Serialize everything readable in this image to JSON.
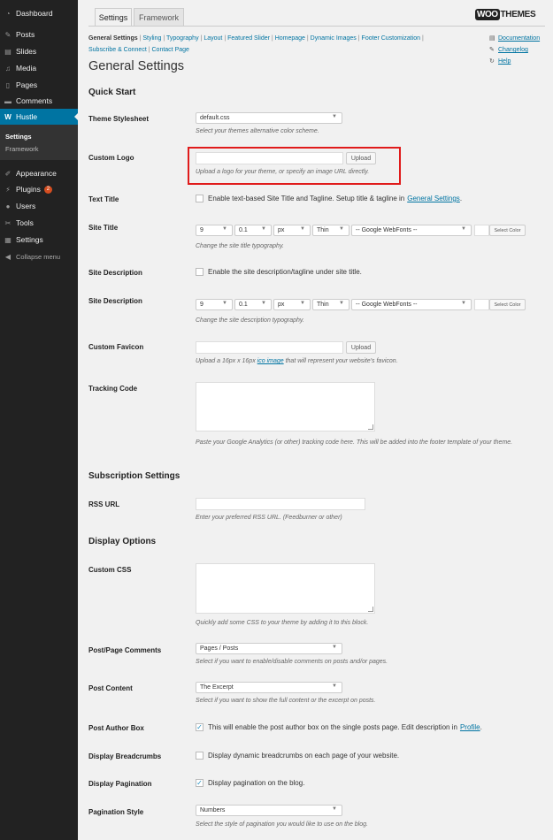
{
  "sidebar": {
    "items": [
      {
        "label": "Dashboard",
        "icon": "dashboard-icon",
        "glyph": "◔"
      },
      {
        "label": "Posts",
        "icon": "pin-icon",
        "glyph": "✎"
      },
      {
        "label": "Slides",
        "icon": "slides-icon",
        "glyph": "▤"
      },
      {
        "label": "Media",
        "icon": "media-icon",
        "glyph": "♫"
      },
      {
        "label": "Pages",
        "icon": "pages-icon",
        "glyph": "▯"
      },
      {
        "label": "Comments",
        "icon": "comment-icon",
        "glyph": "▬"
      },
      {
        "label": "Hustle",
        "icon": "woo-icon",
        "glyph": "W"
      },
      {
        "label": "Appearance",
        "icon": "brush-icon",
        "glyph": "✐"
      },
      {
        "label": "Plugins",
        "icon": "plug-icon",
        "glyph": "⚡",
        "badge": "2"
      },
      {
        "label": "Users",
        "icon": "user-icon",
        "glyph": "●"
      },
      {
        "label": "Tools",
        "icon": "wrench-icon",
        "glyph": "✂"
      },
      {
        "label": "Settings",
        "icon": "settings-icon",
        "glyph": "▦"
      },
      {
        "label": "Collapse menu",
        "icon": "collapse-icon",
        "glyph": "◀"
      }
    ],
    "submenu": [
      "Settings",
      "Framework"
    ]
  },
  "tabs": [
    "Settings",
    "Framework"
  ],
  "logo": {
    "woo": "WOO",
    "themes": "THEMES"
  },
  "subnav": [
    "General Settings",
    "Styling",
    "Typography",
    "Layout",
    "Featured Slider",
    "Homepage",
    "Dynamic Images",
    "Footer Customization",
    "Subscribe & Connect",
    "Contact Page"
  ],
  "help_links": [
    {
      "label": "Documentation",
      "icon": "document-icon"
    },
    {
      "label": "Changelog",
      "icon": "wrench-icon"
    },
    {
      "label": "Help",
      "icon": "refresh-icon"
    }
  ],
  "page_title": "General Settings",
  "sections": {
    "quick_start": "Quick Start",
    "subscription": "Subscription Settings",
    "display": "Display Options"
  },
  "fields": {
    "stylesheet": {
      "label": "Theme Stylesheet",
      "value": "default.css",
      "desc": "Select your themes alternative color scheme."
    },
    "logo": {
      "label": "Custom Logo",
      "button": "Upload",
      "desc": "Upload a logo for your theme, or specify an image URL directly."
    },
    "text_title": {
      "label": "Text Title",
      "text": "Enable text-based Site Title and Tagline. Setup title & tagline in",
      "link": "General Settings",
      "suffix": "."
    },
    "site_title": {
      "label": "Site Title",
      "size": "9",
      "line": "0.1",
      "unit": "px",
      "weight": "Thin",
      "font": "-- Google WebFonts --",
      "color_btn": "Select Color",
      "desc": "Change the site title typography."
    },
    "site_desc_toggle": {
      "label": "Site Description",
      "text": "Enable the site description/tagline under site title."
    },
    "site_desc": {
      "label": "Site Description",
      "size": "9",
      "line": "0.1",
      "unit": "px",
      "weight": "Thin",
      "font": "-- Google WebFonts --",
      "color_btn": "Select Color",
      "desc": "Change the site description typography."
    },
    "favicon": {
      "label": "Custom Favicon",
      "button": "Upload",
      "desc_pre": "Upload a 16px x 16px",
      "desc_link": "ico image",
      "desc_post": "that will represent your website's favicon."
    },
    "tracking": {
      "label": "Tracking Code",
      "desc": "Paste your Google Analytics (or other) tracking code here. This will be added into the footer template of your theme."
    },
    "rss": {
      "label": "RSS URL",
      "desc": "Enter your preferred RSS URL. (Feedburner or other)"
    },
    "css": {
      "label": "Custom CSS",
      "desc": "Quickly add some CSS to your theme by adding it to this block."
    },
    "comments": {
      "label": "Post/Page Comments",
      "value": "Pages / Posts",
      "desc": "Select if you want to enable/disable comments on posts and/or pages."
    },
    "content": {
      "label": "Post Content",
      "value": "The Excerpt",
      "desc": "Select if you want to show the full content or the excerpt on posts."
    },
    "author": {
      "label": "Post Author Box",
      "text": "This will enable the post author box on the single posts page. Edit description in",
      "link": "Profile",
      "suffix": "."
    },
    "breadcrumbs": {
      "label": "Display Breadcrumbs",
      "text": "Display dynamic breadcrumbs on each page of your website."
    },
    "pagination": {
      "label": "Display Pagination",
      "text": "Display pagination on the blog."
    },
    "pag_style": {
      "label": "Pagination Style",
      "value": "Numbers",
      "desc": "Select the style of pagination you would like to use on the blog."
    }
  },
  "glyphs": {
    "arrow": "▼",
    "check": "✓",
    "sep": "|"
  }
}
